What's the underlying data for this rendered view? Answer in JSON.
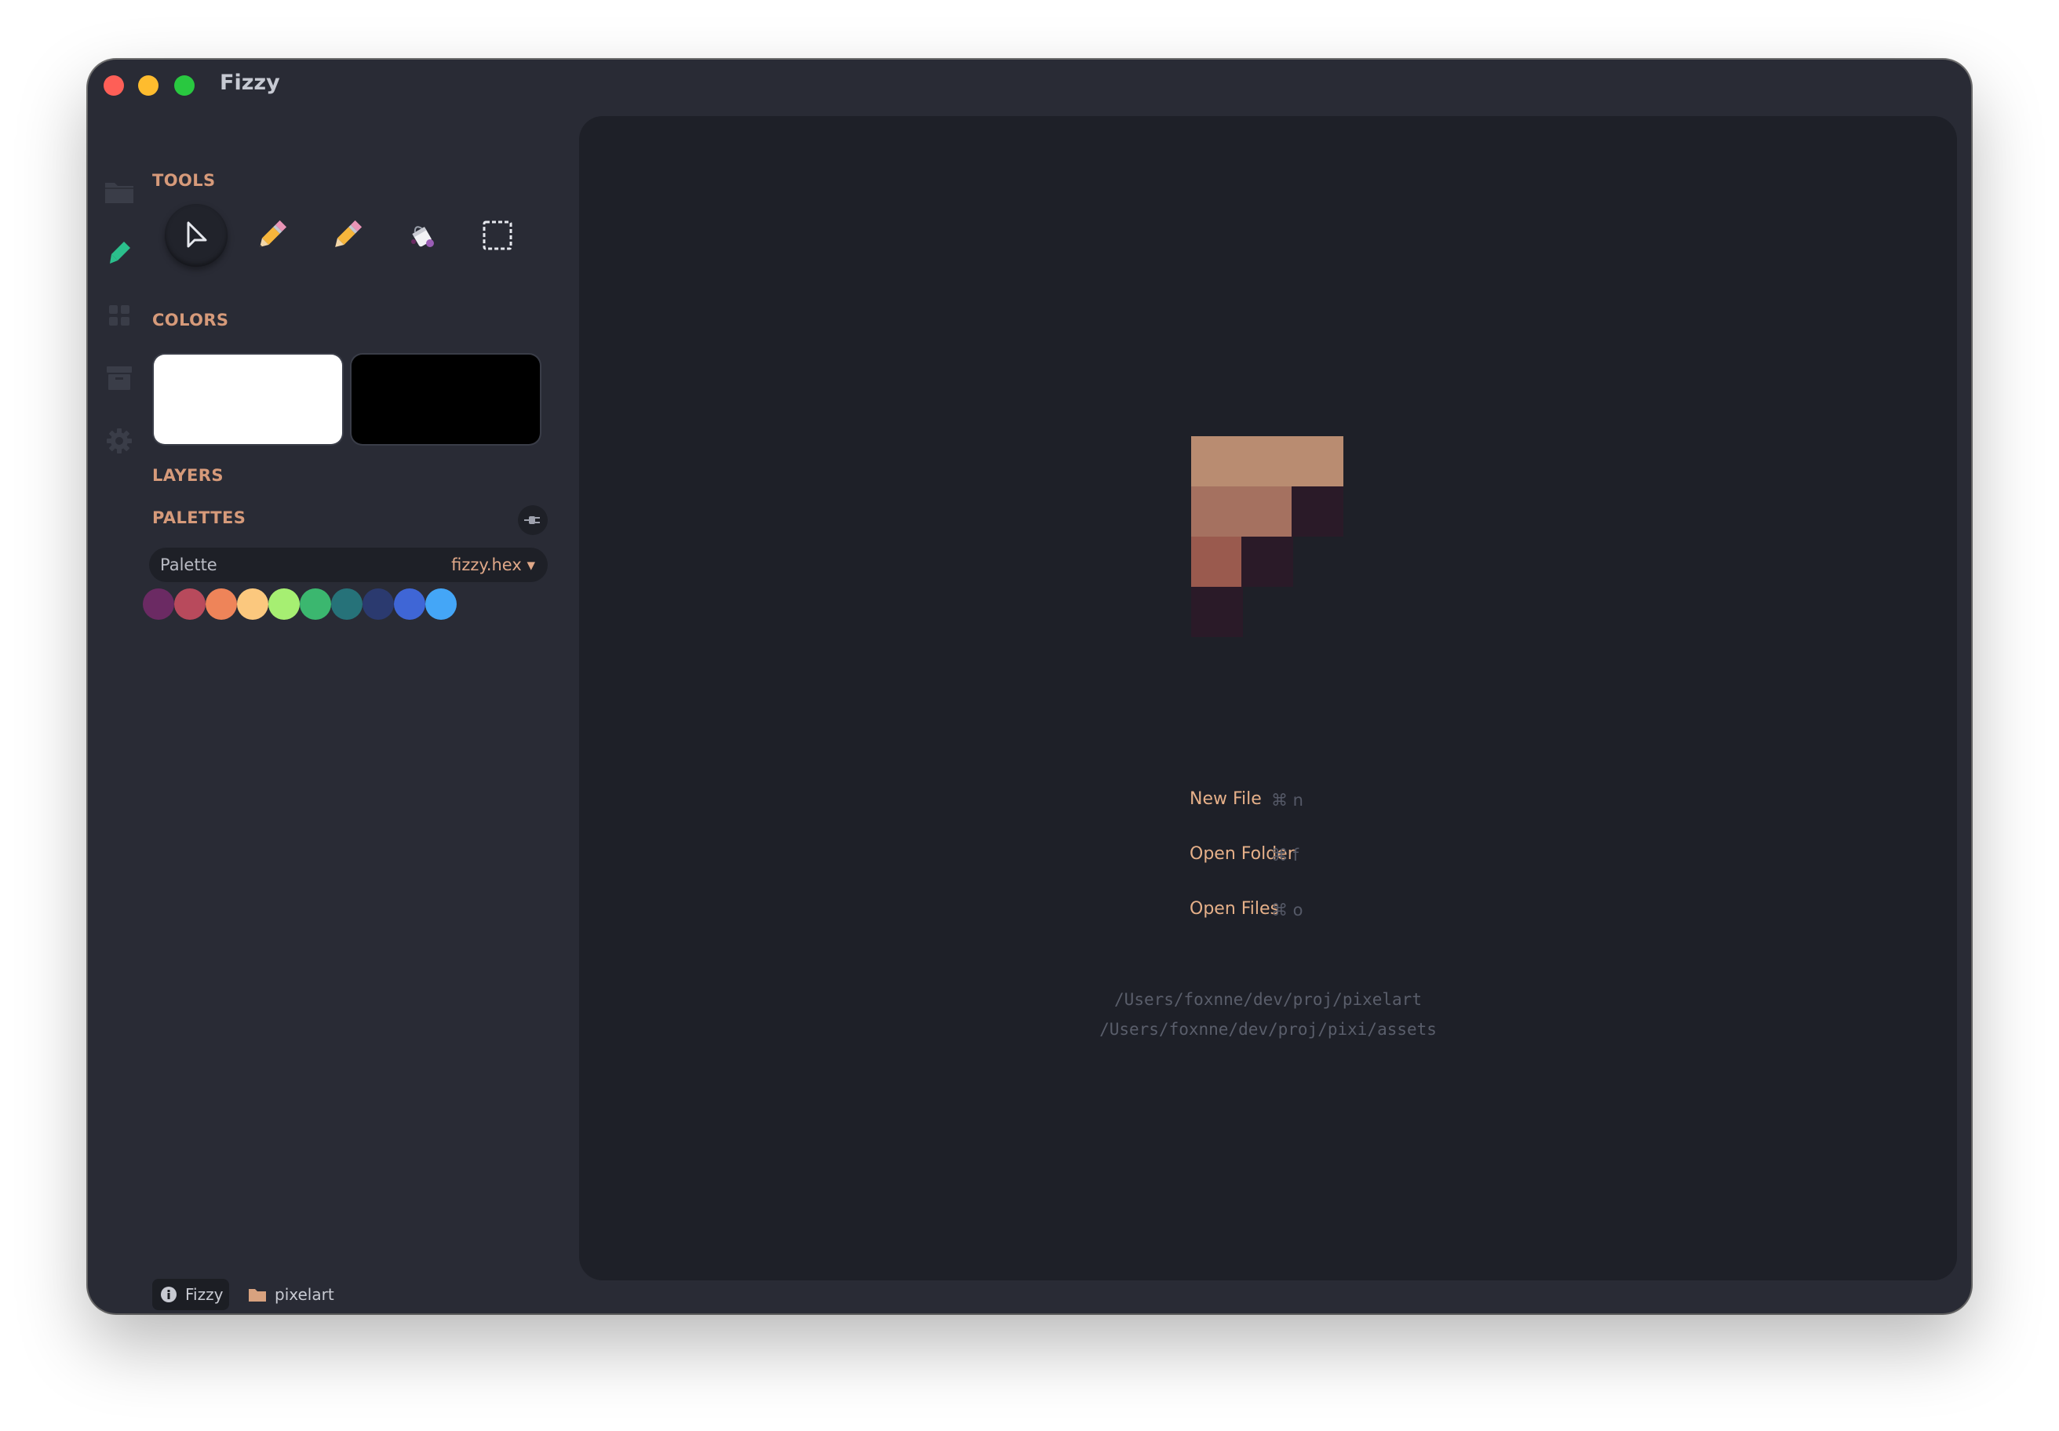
{
  "window": {
    "title": "Fizzy"
  },
  "activity_bar": {
    "items": [
      {
        "name": "files",
        "icon": "folder-icon",
        "active": false
      },
      {
        "name": "draw",
        "icon": "brush-icon",
        "active": true
      },
      {
        "name": "grid",
        "icon": "grid-icon",
        "active": false
      },
      {
        "name": "archive",
        "icon": "archive-icon",
        "active": false
      },
      {
        "name": "settings",
        "icon": "gear-icon",
        "active": false
      }
    ],
    "active_color": "#2bbf8c",
    "inactive_color": "#3a3d48"
  },
  "sidebar": {
    "tools_title": "TOOLS",
    "tools": [
      {
        "name": "pointer",
        "icon": "cursor-icon",
        "selected": true
      },
      {
        "name": "pencil",
        "icon": "pencil-icon",
        "selected": false
      },
      {
        "name": "pencil-alt",
        "icon": "pencil-icon",
        "selected": false
      },
      {
        "name": "fill",
        "icon": "paint-bucket-icon",
        "selected": false
      },
      {
        "name": "selection",
        "icon": "marquee-select-icon",
        "selected": false
      }
    ],
    "colors_title": "COLORS",
    "primary_color": "#ffffff",
    "secondary_color": "#000000",
    "layers_title": "LAYERS",
    "palettes_title": "PALETTES",
    "palette_label": "Palette",
    "palette_value": "fizzy.hex ▾",
    "palette_colors": [
      "#6b2a63",
      "#b84a5c",
      "#ee8459",
      "#fbc87e",
      "#a6ef72",
      "#3bb76f",
      "#267279",
      "#2b3a6f",
      "#3f66d6",
      "#44a6f7"
    ]
  },
  "welcome": {
    "logo_colors": [
      "#b98c71",
      "#a57160",
      "#9a5a4e",
      "#2a1a28"
    ],
    "actions": [
      {
        "label": "New File",
        "shortcut": "⌘ n"
      },
      {
        "label": "Open Folder",
        "shortcut": "⌘ f"
      },
      {
        "label": "Open Files",
        "shortcut": "⌘ o"
      }
    ],
    "recent": [
      "/Users/foxnne/dev/proj/pixelart",
      "/Users/foxnne/dev/proj/pixi/assets"
    ]
  },
  "status_bar": {
    "app_label": "Fizzy",
    "folder_label": "pixelart"
  }
}
